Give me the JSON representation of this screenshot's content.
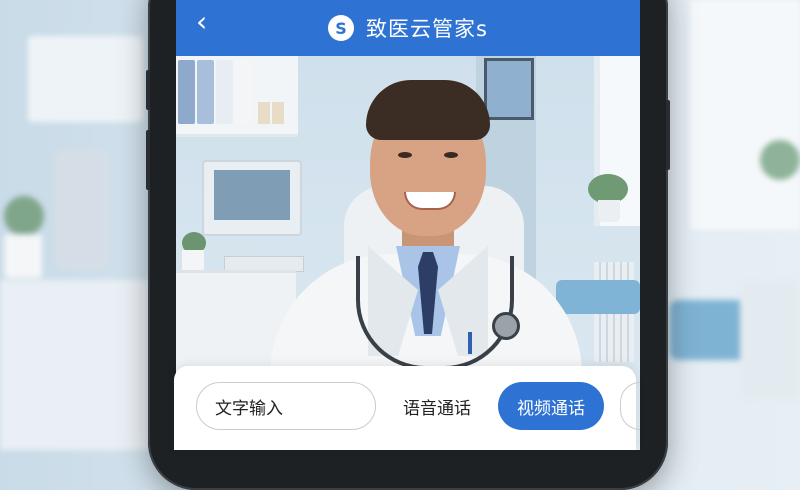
{
  "header": {
    "back_icon": "chevron-left-icon",
    "logo_letter": "S",
    "title": "致医云管家s",
    "background_color": "#2e73d3"
  },
  "video_call": {
    "participant": "doctor"
  },
  "actions": {
    "text_input_label": "文字输入",
    "voice_call_label": "语音通话",
    "video_call_label": "视频通话",
    "accent_color": "#2e73d3"
  }
}
